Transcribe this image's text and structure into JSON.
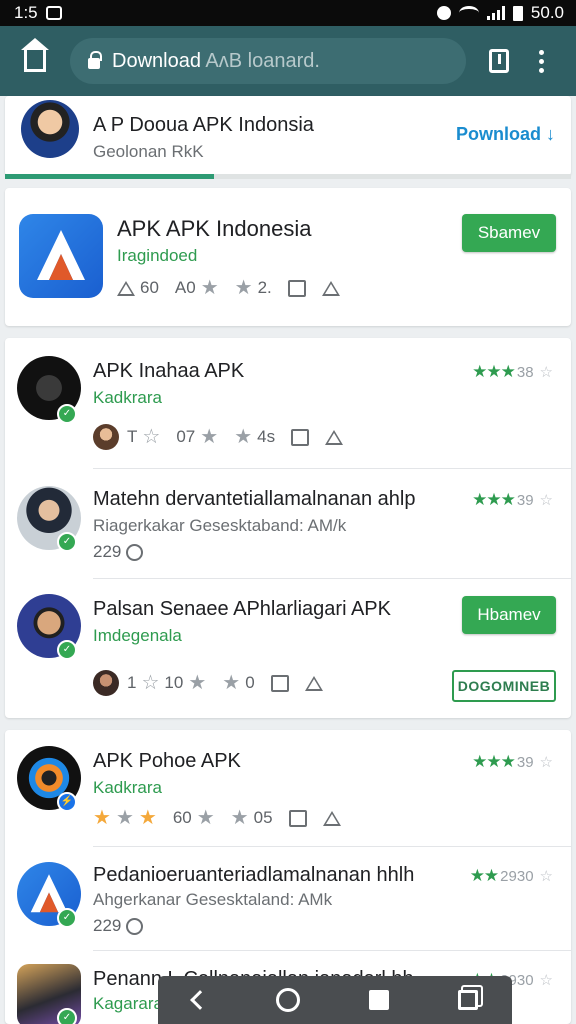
{
  "status_bar": {
    "time": "1:5",
    "battery": "50.0"
  },
  "toolbar": {
    "url_main": "Download",
    "url_rest": "AᴧB loanard."
  },
  "items": [
    {
      "title": "A P Dooua APK Indonsia",
      "subtitle": "Geolonan RkK",
      "action_link": "Pownload"
    },
    {
      "title": "APK APK Indonesia",
      "subtitle": "Iragindoed",
      "meta": [
        "60",
        "A0",
        "2."
      ],
      "button": "Sbamev"
    },
    {
      "title": "APK Inahaa APK",
      "subtitle": "Kadkrara",
      "meta": [
        "T",
        "07",
        "4s"
      ],
      "rating": "38"
    },
    {
      "title": "Matehn dervantetiallamalnanan ahlp",
      "subtitle": "Riagerkakar Gesesktaband: AM/k",
      "extra": "229",
      "rating": "39"
    },
    {
      "title": "Palsan Senaee APhlarliagari APK",
      "subtitle": "Imdegenala",
      "meta": [
        "1",
        "10",
        "0"
      ],
      "button": "Hbamev",
      "button_outline": "DOGOMINEB"
    },
    {
      "title": "APK Pohoe APK",
      "subtitle": "Kadkrara",
      "meta": [
        "60",
        "05"
      ],
      "rating": "39"
    },
    {
      "title": "Pedanioeruanteriadlamalnanan hhlh",
      "subtitle": "Ahgerkanar Gesesktaland: AMk",
      "extra": "229",
      "rating": "2930"
    },
    {
      "title": "Penann L Cellnanaiallan ianadarl hh",
      "subtitle": "Kagarara",
      "rating": "2930"
    }
  ],
  "colors": {
    "toolbar": "#2f5e63",
    "accent_green": "#34a853",
    "link_blue": "#1a8ccf"
  }
}
